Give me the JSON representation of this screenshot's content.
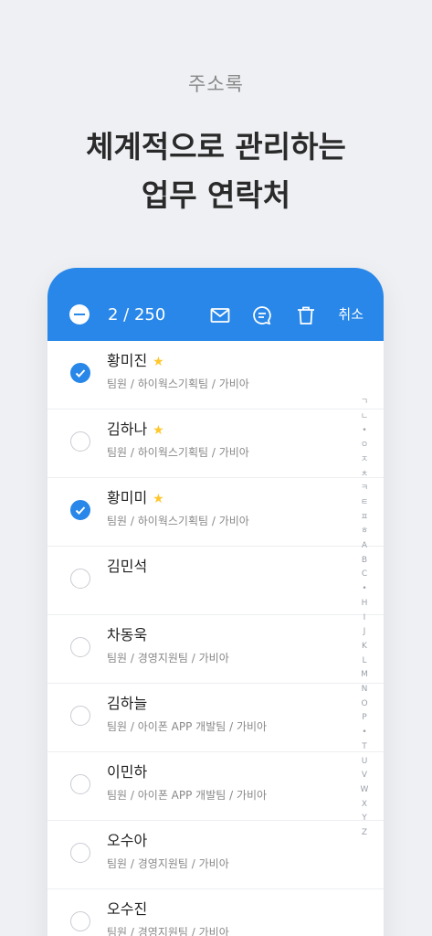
{
  "caption": "주소록",
  "headline": {
    "line1": "체계적으로 관리하는",
    "line2": "업무 연락처"
  },
  "toolbar": {
    "count": "2 / 250",
    "cancel": "취소",
    "icons": [
      "minus-circle",
      "mail",
      "chat",
      "trash"
    ]
  },
  "colors": {
    "accent": "#2887e8",
    "star": "#ffc72c"
  },
  "contacts": [
    {
      "name": "황미진",
      "sub": "팀원 / 하이웍스기획팀 / 가비아",
      "starred": true,
      "checked": true
    },
    {
      "name": "김하나",
      "sub": "팀원 / 하이웍스기획팀 / 가비아",
      "starred": true,
      "checked": false
    },
    {
      "name": "황미미",
      "sub": "팀원 / 하이웍스기획팀 / 가비아",
      "starred": true,
      "checked": true
    },
    {
      "name": "김민석",
      "sub": "",
      "starred": false,
      "checked": false
    },
    {
      "name": "차동욱",
      "sub": "팀원 / 경영지원팀 / 가비아",
      "starred": false,
      "checked": false
    },
    {
      "name": "김하늘",
      "sub": "팀원 / 아이폰 APP 개발팀 / 가비아",
      "starred": false,
      "checked": false
    },
    {
      "name": "이민하",
      "sub": "팀원 / 아이폰 APP 개발팀 / 가비아",
      "starred": false,
      "checked": false
    },
    {
      "name": "오수아",
      "sub": "팀원 / 경영지원팀 / 가비아",
      "starred": false,
      "checked": false
    },
    {
      "name": "오수진",
      "sub": "팀원 / 경영지원팀 / 가비아",
      "starred": false,
      "checked": false
    }
  ],
  "index_letters": [
    "ㄱ",
    "ㄴ",
    "•",
    "ㅇ",
    "ㅈ",
    "ㅊ",
    "ㅋ",
    "ㅌ",
    "ㅍ",
    "ㅎ",
    "A",
    "B",
    "C",
    "•",
    "H",
    "I",
    "J",
    "K",
    "L",
    "M",
    "N",
    "O",
    "P",
    "•",
    "T",
    "U",
    "V",
    "W",
    "X",
    "Y",
    "Z"
  ]
}
